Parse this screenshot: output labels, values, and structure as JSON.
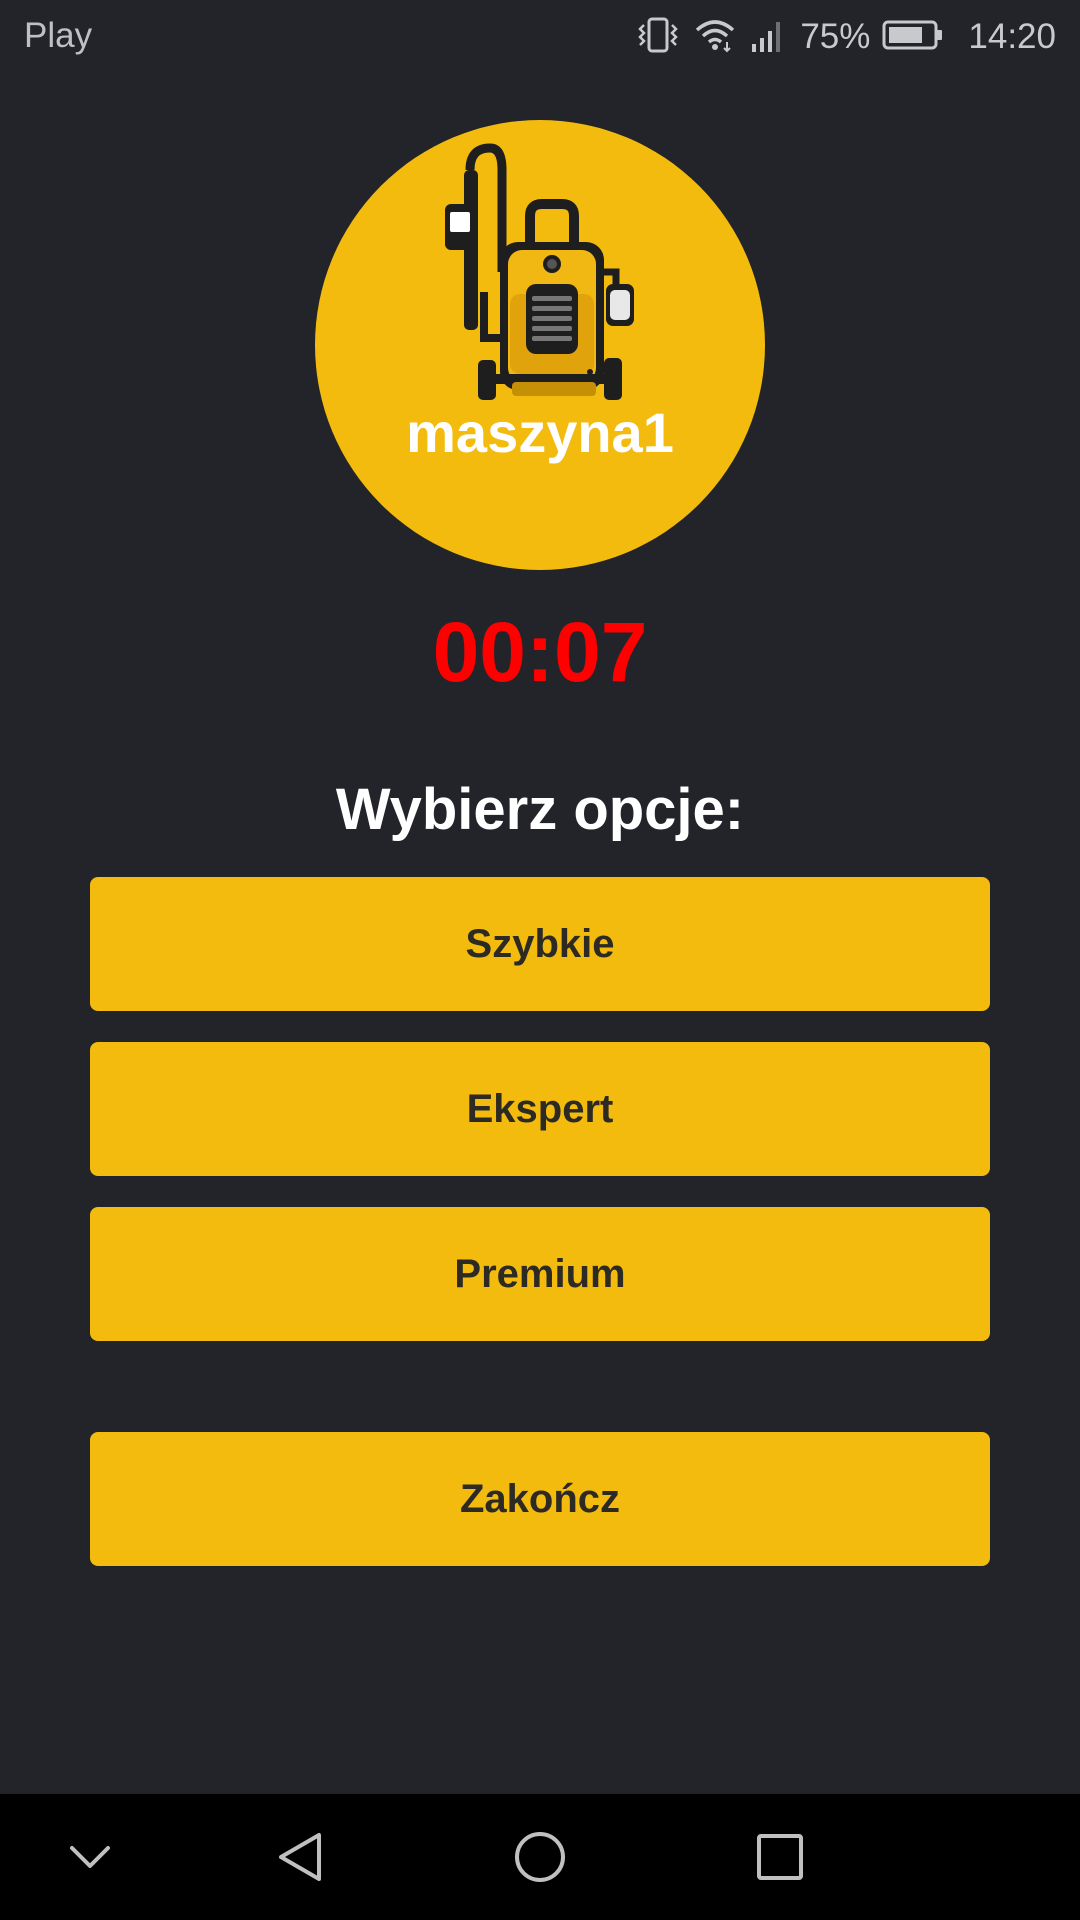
{
  "status_bar": {
    "carrier": "Play",
    "battery_percent": "75%",
    "time": "14:20",
    "icons": [
      "vibrate-icon",
      "wifi-icon",
      "signal-icon",
      "battery-icon"
    ]
  },
  "machine": {
    "name": "maszyna1",
    "icon": "pressure-washer-icon",
    "circle_color": "#f3bb0e"
  },
  "timer": {
    "value": "00:07",
    "color": "#ff0000"
  },
  "prompt": "Wybierz opcje:",
  "options": [
    {
      "label": "Szybkie"
    },
    {
      "label": "Ekspert"
    },
    {
      "label": "Premium"
    }
  ],
  "finish_button": {
    "label": "Zakończ"
  },
  "nav_bar": {
    "buttons": [
      "hide-keyboard-icon",
      "back-icon",
      "home-icon",
      "recents-icon"
    ]
  },
  "colors": {
    "background": "#222429",
    "accent": "#f3bb0e",
    "button_text": "#2c2a22"
  }
}
